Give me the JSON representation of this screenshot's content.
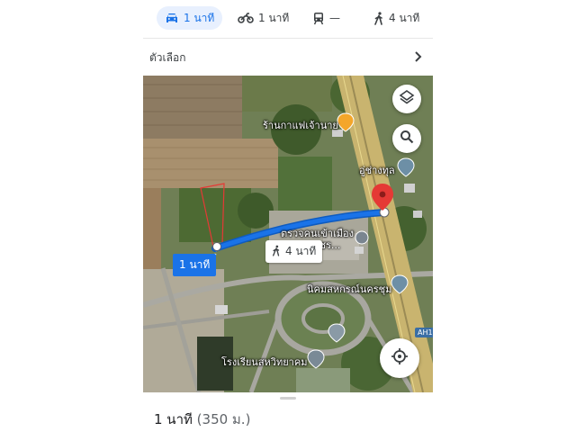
{
  "modes": {
    "drive": {
      "label": "1 นาที",
      "icon": "car-icon",
      "active": true
    },
    "motorcycle": {
      "label": "1 นาที",
      "icon": "motorcycle-icon"
    },
    "transit": {
      "label": "—",
      "icon": "train-icon"
    },
    "walk": {
      "label": "4 นาที",
      "icon": "walking-icon"
    }
  },
  "options": {
    "label": "ตัวเลือก"
  },
  "map": {
    "places": {
      "coffee": "ร้านกาแฟเจ้านาย",
      "garage": "อู่ช่างทุล",
      "immigration_line1": "ตรวจคนเข้าเมือง",
      "immigration_line2": "นเพชร...",
      "cooperative": "นิคมสหกรณ์นครชุม",
      "school": "โรงเรียนสหวิทยาคม"
    },
    "route_duration_badge": "1 นาที",
    "walk_badge": "4 นาที",
    "road_shield": "AH1",
    "route_color": "#1a73e8",
    "destination_pin_color": "#e53935"
  },
  "sheet": {
    "title": "1 นาที",
    "distance": "(350 ม.)"
  }
}
